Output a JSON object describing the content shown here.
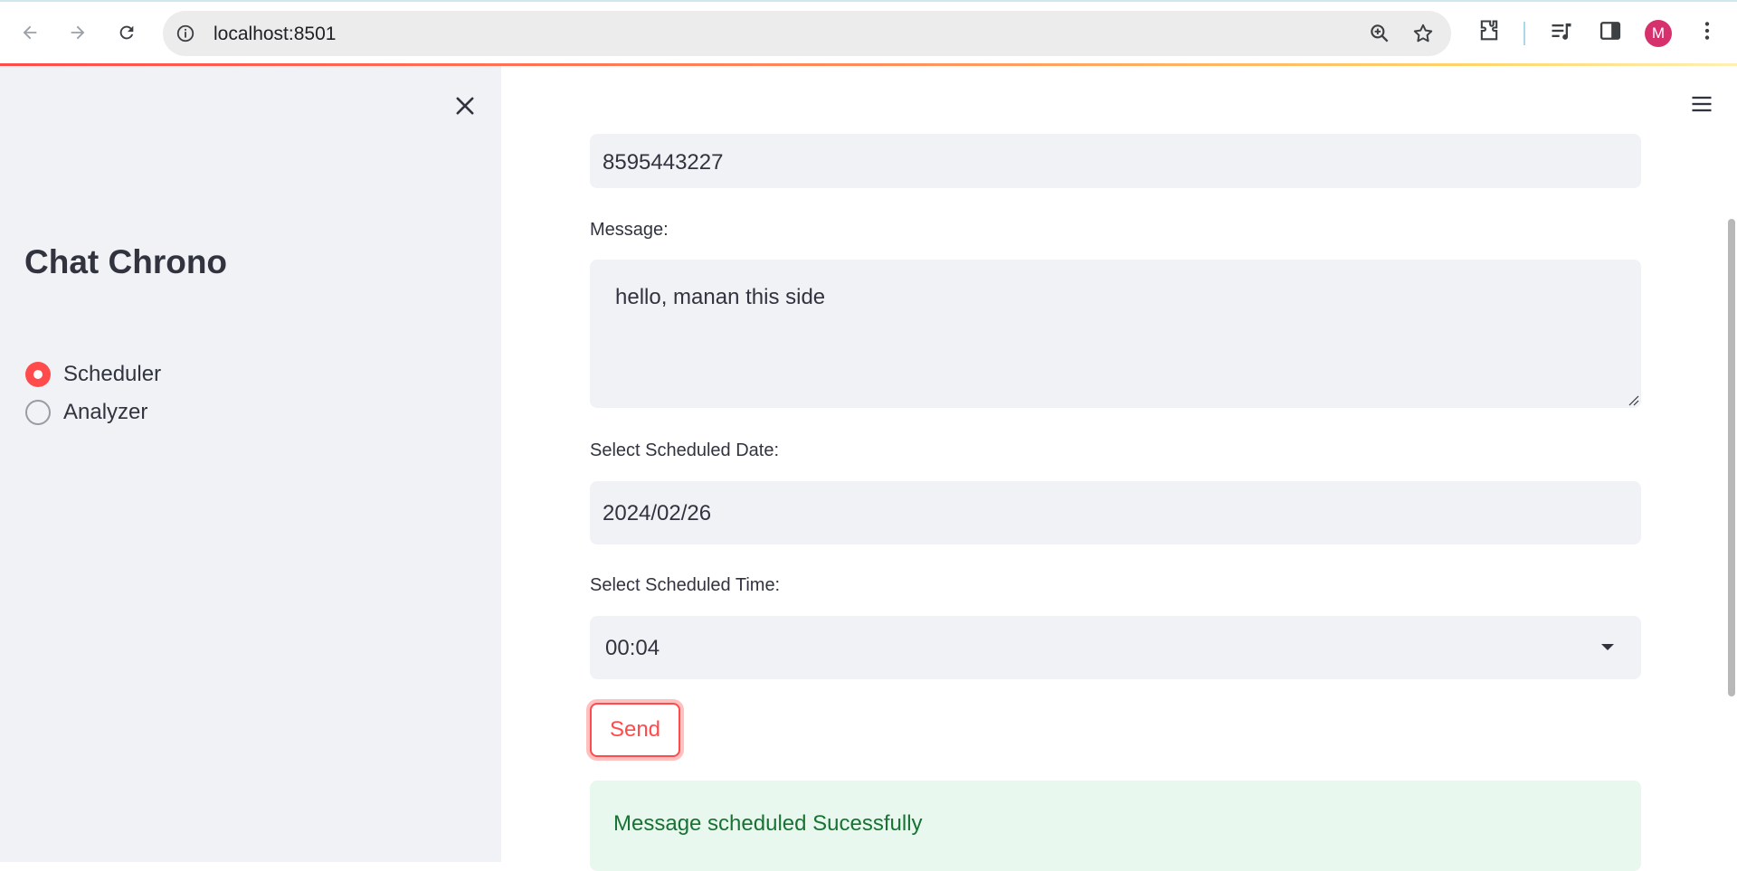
{
  "browser": {
    "url": "localhost:8501",
    "profile_initial": "M",
    "avatar_color": "#d6306d"
  },
  "sidebar": {
    "title": "Chat Chrono",
    "options": [
      {
        "label": "Scheduler",
        "selected": true
      },
      {
        "label": "Analyzer",
        "selected": false
      }
    ]
  },
  "form": {
    "phone_value": "8595443227",
    "message_label": "Message:",
    "message_value": "hello, manan this side",
    "date_label": "Select Scheduled Date:",
    "date_value": "2024/02/26",
    "time_label": "Select Scheduled Time:",
    "time_value": "00:04",
    "send_label": "Send"
  },
  "status": {
    "success_message": "Message scheduled Sucessfully"
  },
  "colors": {
    "accent": "#ff4b4b",
    "sidebar_bg": "#f0f2f6",
    "success_bg": "#e8f8ee",
    "success_text": "#177233"
  }
}
